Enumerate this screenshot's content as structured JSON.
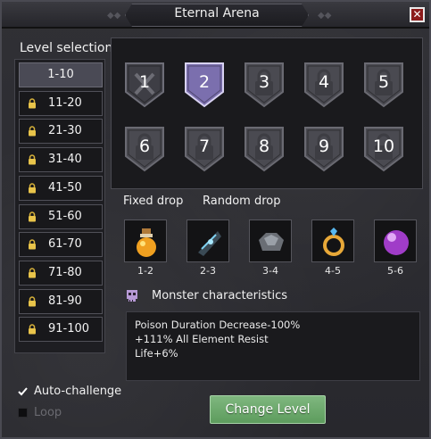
{
  "window": {
    "title": "Eternal Arena",
    "close_icon": "close-icon"
  },
  "level_selection": {
    "label": "Level selection",
    "items": [
      {
        "label": "1-10",
        "locked": false,
        "selected": true
      },
      {
        "label": "11-20",
        "locked": true
      },
      {
        "label": "21-30",
        "locked": true
      },
      {
        "label": "31-40",
        "locked": true
      },
      {
        "label": "41-50",
        "locked": true
      },
      {
        "label": "51-60",
        "locked": true
      },
      {
        "label": "61-70",
        "locked": true
      },
      {
        "label": "71-80",
        "locked": true
      },
      {
        "label": "81-90",
        "locked": true
      },
      {
        "label": "91-100",
        "locked": true
      }
    ]
  },
  "levels": [
    {
      "num": "1",
      "state": "completed"
    },
    {
      "num": "2",
      "state": "selected"
    },
    {
      "num": "3",
      "state": "locked"
    },
    {
      "num": "4",
      "state": "locked"
    },
    {
      "num": "5",
      "state": "locked"
    },
    {
      "num": "6",
      "state": "locked"
    },
    {
      "num": "7",
      "state": "locked"
    },
    {
      "num": "8",
      "state": "locked"
    },
    {
      "num": "9",
      "state": "locked"
    },
    {
      "num": "10",
      "state": "locked"
    }
  ],
  "drops": {
    "fixed_label": "Fixed drop",
    "random_label": "Random drop",
    "items": [
      {
        "icon": "potion-icon",
        "count": "1-2"
      },
      {
        "icon": "shard-icon",
        "count": "2-3"
      },
      {
        "icon": "ore-icon",
        "count": "3-4"
      },
      {
        "icon": "ring-icon",
        "count": "4-5"
      },
      {
        "icon": "orb-icon",
        "count": "5-6"
      }
    ]
  },
  "monster": {
    "heading": "Monster characteristics",
    "lines": [
      "Poison Duration Decrease-100%",
      "+111% All Element Resist",
      "Life+6%"
    ]
  },
  "controls": {
    "auto_challenge": {
      "label": "Auto-challenge",
      "checked": true
    },
    "loop": {
      "label": "Loop",
      "checked": false
    },
    "change_level": "Change Level"
  },
  "colors": {
    "selected_level": "#7b6fae",
    "button_green": "#6aa86a",
    "close_red": "#8c1b1b"
  }
}
